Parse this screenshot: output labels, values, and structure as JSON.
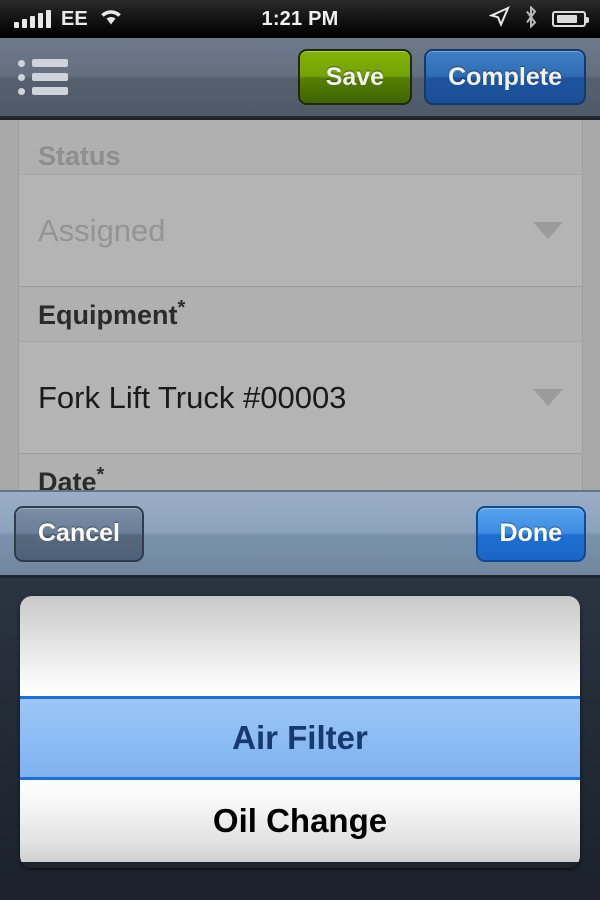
{
  "statusbar": {
    "carrier": "EE",
    "time": "1:21 PM",
    "signal_icon": "signal-bars-icon",
    "wifi_icon": "wifi-icon",
    "location_icon": "location-arrow-icon",
    "bluetooth_icon": "bluetooth-icon",
    "battery_icon": "battery-charging-icon"
  },
  "navbar": {
    "menu_icon": "list-menu-icon",
    "save_label": "Save",
    "complete_label": "Complete",
    "save_color": "#74a206",
    "complete_color": "#2f6cb4"
  },
  "form": {
    "fields": [
      {
        "label": "Status",
        "required": false,
        "value": "Assigned",
        "dimmed": true
      },
      {
        "label": "Equipment",
        "required": true,
        "value": "Fork Lift Truck #00003",
        "dimmed": false
      },
      {
        "label": "Date",
        "required": true,
        "value": "",
        "dimmed": false
      }
    ],
    "required_marker": "*",
    "dropdown_icon": "chevron-down-icon"
  },
  "picker": {
    "cancel_label": "Cancel",
    "done_label": "Done",
    "selected_index": 0,
    "options": [
      {
        "label": "Air Filter",
        "selected": true
      },
      {
        "label": "Oil Change",
        "selected": false
      }
    ],
    "selection_color": "#1c6fd8",
    "selected_text_color": "#16396e"
  }
}
